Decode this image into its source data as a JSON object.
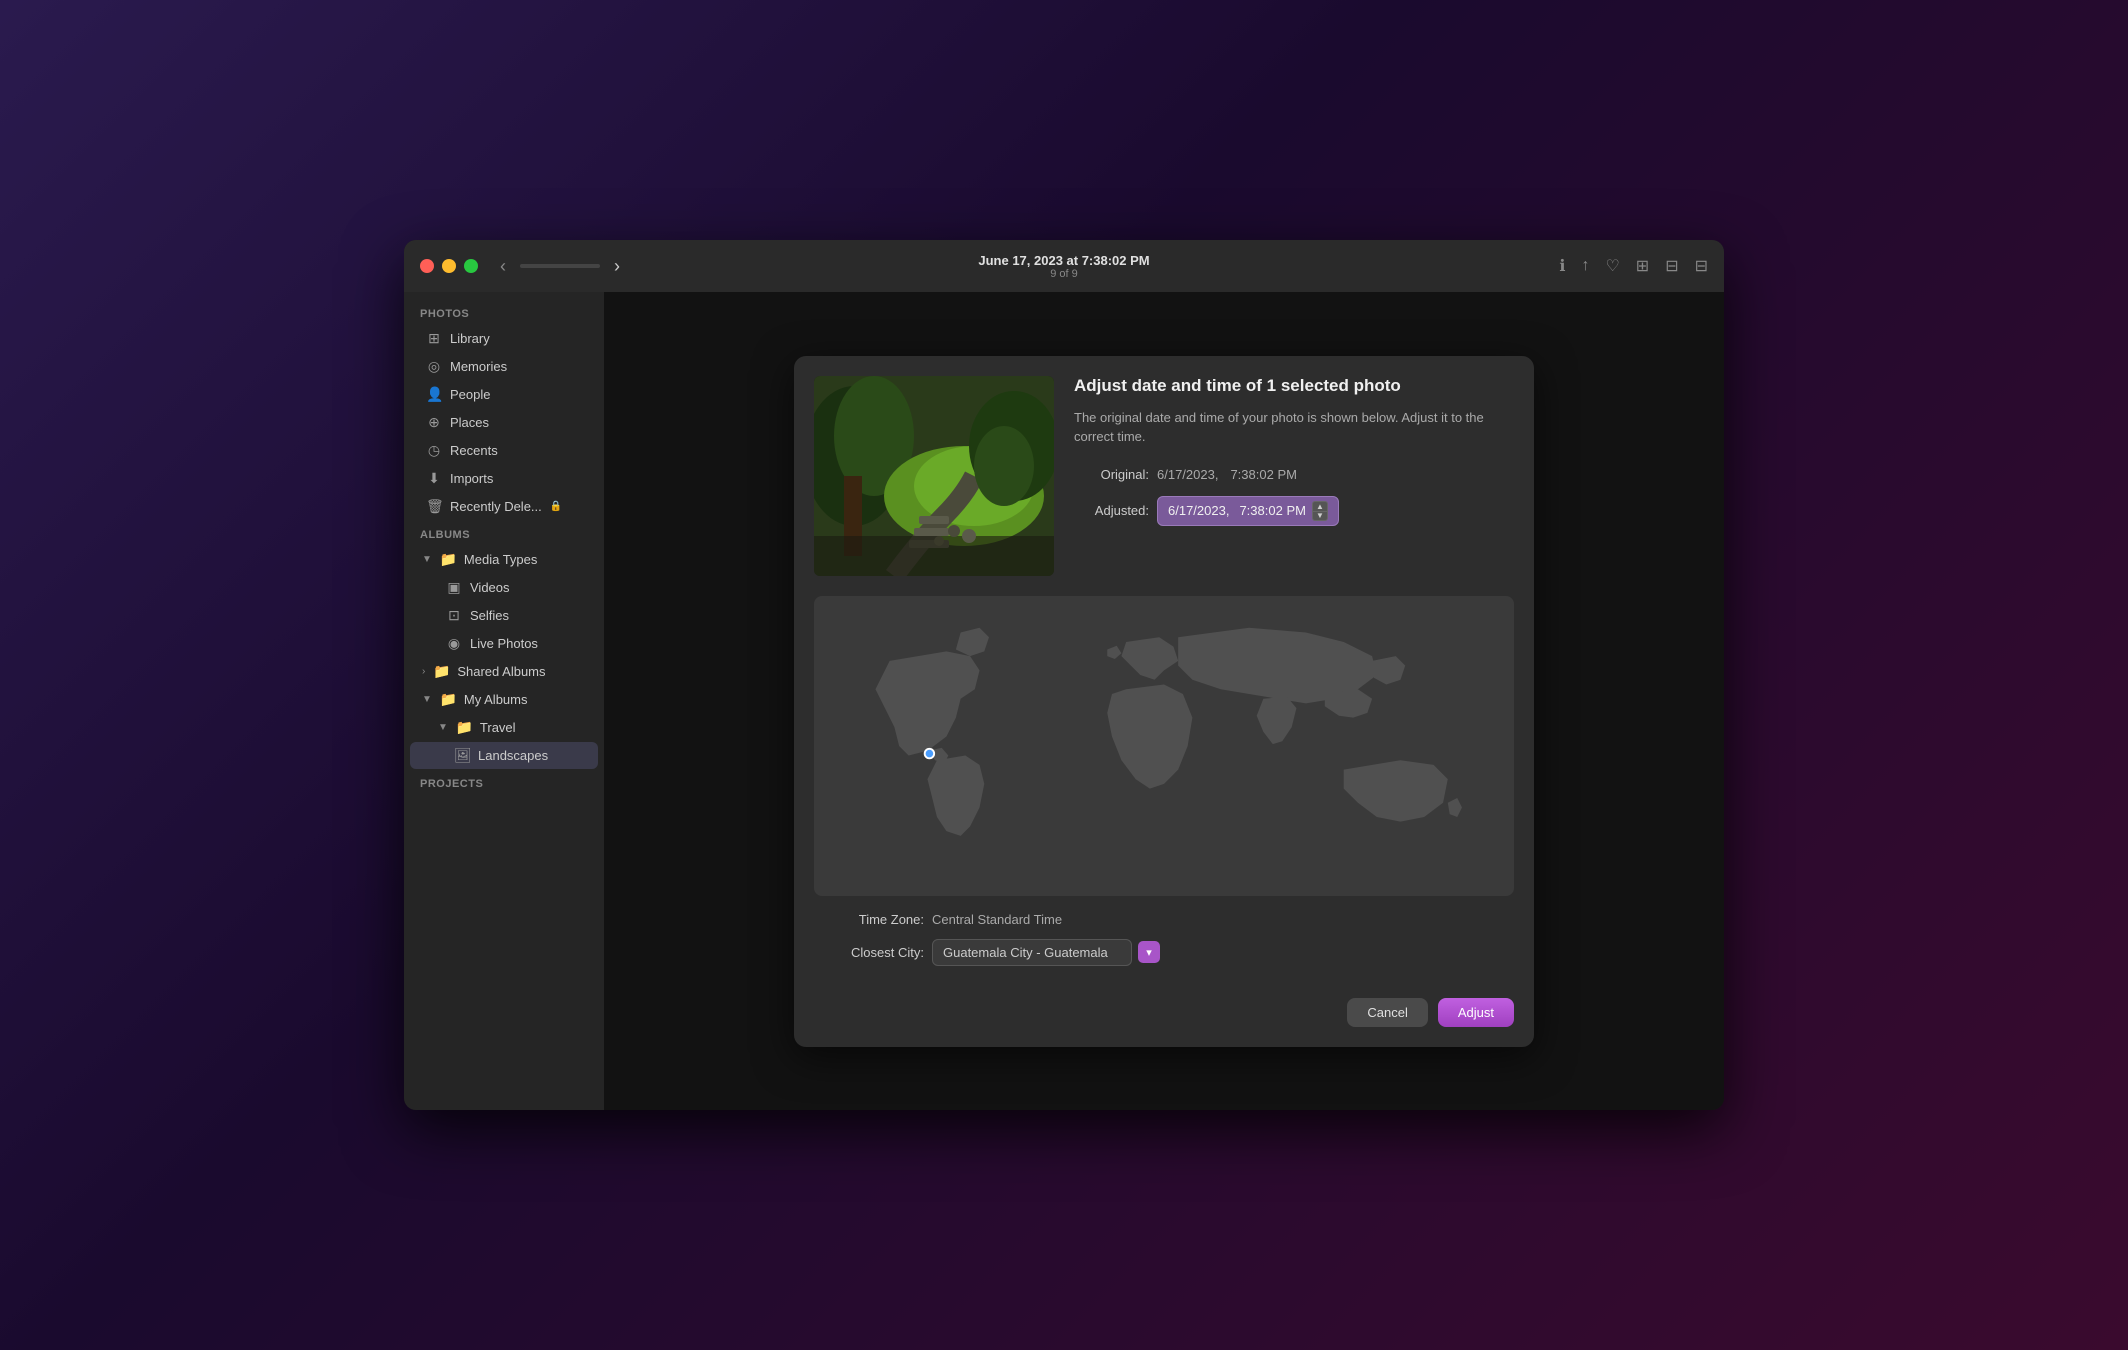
{
  "window": {
    "title": "June 17, 2023 at 7:38:02 PM",
    "subtitle": "9 of 9"
  },
  "traffic_lights": {
    "close": "close-button",
    "minimize": "minimize-button",
    "maximize": "maximize-button"
  },
  "nav": {
    "back_arrow": "‹",
    "forward_arrow": "›"
  },
  "sidebar": {
    "photos_header": "Photos",
    "albums_header": "Albums",
    "projects_header": "Projects",
    "items": [
      {
        "id": "library",
        "label": "Library",
        "icon": "⊞",
        "indent": 0
      },
      {
        "id": "memories",
        "label": "Memories",
        "icon": "◎",
        "indent": 0
      },
      {
        "id": "people",
        "label": "People",
        "icon": "👤",
        "indent": 0
      },
      {
        "id": "places",
        "label": "Places",
        "icon": "⊕",
        "indent": 0
      },
      {
        "id": "recents",
        "label": "Recents",
        "icon": "◷",
        "indent": 0
      },
      {
        "id": "imports",
        "label": "Imports",
        "icon": "⬇",
        "indent": 0
      },
      {
        "id": "recently-deleted",
        "label": "Recently Dele...",
        "icon": "🗑",
        "indent": 0,
        "lock": true
      }
    ],
    "albums_items": [
      {
        "id": "media-types",
        "label": "Media Types",
        "icon": "📁",
        "indent": 0,
        "chevron": "▼"
      },
      {
        "id": "videos",
        "label": "Videos",
        "icon": "▣",
        "indent": 1
      },
      {
        "id": "selfies",
        "label": "Selfies",
        "icon": "⊡",
        "indent": 1
      },
      {
        "id": "live-photos",
        "label": "Live Photos",
        "icon": "◉",
        "indent": 1
      },
      {
        "id": "shared-albums",
        "label": "Shared Albums",
        "icon": "📁",
        "indent": 0,
        "chevron": "›"
      },
      {
        "id": "my-albums",
        "label": "My Albums",
        "icon": "📁",
        "indent": 0,
        "chevron": "▼"
      },
      {
        "id": "travel",
        "label": "Travel",
        "icon": "📁",
        "indent": 1,
        "chevron": "▼"
      },
      {
        "id": "landscapes",
        "label": "Landscapes",
        "icon": "🖼",
        "indent": 2,
        "selected": true
      }
    ]
  },
  "modal": {
    "title": "Adjust date and time of 1 selected photo",
    "description": "The original date and time of your photo is shown below. Adjust it to the correct time.",
    "original_label": "Original:",
    "original_date": "6/17/2023,",
    "original_time": "7:38:02 PM",
    "adjusted_label": "Adjusted:",
    "adjusted_date": "6/17/2023,",
    "adjusted_time": "7:38:02 PM",
    "timezone_label": "Time Zone:",
    "timezone_value": "Central Standard Time",
    "city_label": "Closest City:",
    "city_value": "Guatemala City - Guatemala",
    "cancel_button": "Cancel",
    "adjust_button": "Adjust"
  },
  "title_icons": [
    "ℹ",
    "↑",
    "♡",
    "⬒",
    "⊞",
    "⊟"
  ]
}
